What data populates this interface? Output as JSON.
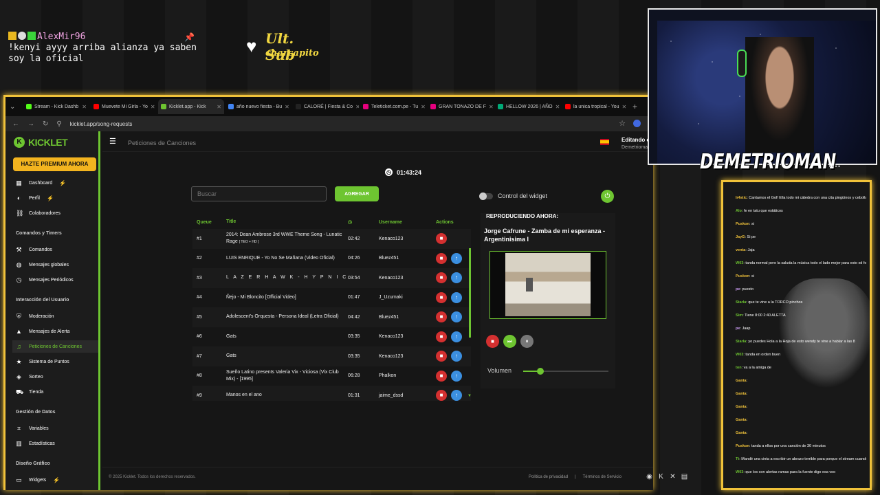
{
  "stream_chat": {
    "user": "AlexMir96",
    "message_line1": "!kenyi ayyy arriba alianza ya saben",
    "message_line2": "soy la oficial"
  },
  "sub_alert": {
    "title": "Ult. Sub",
    "name": "charcapito"
  },
  "browser": {
    "tabs": [
      {
        "label": "Stream - Kick Dashb",
        "color": "#53fc18"
      },
      {
        "label": "Muevete Mi Girla - Yo",
        "color": "#ff0000"
      },
      {
        "label": "Kicklet.app - Kick",
        "color": "#6ec531",
        "active": true
      },
      {
        "label": "año nuevo fiesta - Bu",
        "color": "#4285f4"
      },
      {
        "label": "CALORÉ | Fiesta & Co",
        "color": "#222222"
      },
      {
        "label": "Teleticket.com.pe - Tu",
        "color": "#e6007e"
      },
      {
        "label": "GRAN TONAZO DE F",
        "color": "#e6007e"
      },
      {
        "label": "HELLOW 2026 | AÑO",
        "color": "#00aa77"
      },
      {
        "label": "la unica tropical - You",
        "color": "#ff0000"
      }
    ],
    "url": "kicklet.app/song-requests"
  },
  "kicklet": {
    "logo": "KICKLET",
    "premium_button": "HAZTE PREMIUM AHORA",
    "sidebar": {
      "main": [
        {
          "label": "Dashboard",
          "icon": "grid-icon"
        },
        {
          "label": "Perfil",
          "icon": "user-icon"
        },
        {
          "label": "Colaboradores",
          "icon": "link-icon"
        }
      ],
      "section_commands": "Comandos y Timers",
      "commands": [
        {
          "label": "Comandos",
          "icon": "hammer-icon"
        },
        {
          "label": "Mensajes globales",
          "icon": "globe-icon"
        },
        {
          "label": "Mensajes Periódicos",
          "icon": "clock-icon"
        }
      ],
      "section_interaction": "Interacción del Usuario",
      "interaction": [
        {
          "label": "Moderación",
          "icon": "shield-icon"
        },
        {
          "label": "Mensajes de Alerta",
          "icon": "alert-icon"
        },
        {
          "label": "Peticiones de Canciones",
          "icon": "music-icon"
        },
        {
          "label": "Sistema de Puntos",
          "icon": "star-icon"
        },
        {
          "label": "Sorteo",
          "icon": "gift-icon"
        },
        {
          "label": "Tienda",
          "icon": "cart-icon"
        }
      ],
      "section_data": "Gestión de Datos",
      "data": [
        {
          "label": "Variables",
          "icon": "code-icon"
        },
        {
          "label": "Estadísticas",
          "icon": "chart-icon"
        }
      ],
      "section_design": "Diseño Gráfico",
      "design": [
        {
          "label": "Widgets",
          "icon": "widget-icon"
        }
      ]
    },
    "header_title": "Peticiones de Canciones",
    "editing_label": "Editando co",
    "editing_user": "Demetrioman",
    "timer": "01:43:24",
    "search_placeholder": "Buscar",
    "add_button": "AGREGAR",
    "widget_control_label": "Control del widget",
    "table": {
      "headers": {
        "queue": "Queue",
        "title": "Title",
        "username": "Username",
        "actions": "Actions"
      },
      "rows": [
        {
          "queue": "#1",
          "title": "2014: Dean Ambrose 3rd WWE Theme Song - Lunatic Rage",
          "badge": "[ TEO + HD ]",
          "duration": "02:42",
          "username": "Kenaco123"
        },
        {
          "queue": "#2",
          "title": "LUIS ENRIQUE - Yo No Se Mañana (Video Oficial)",
          "duration": "04:26",
          "username": "Bluez451"
        },
        {
          "queue": "#3",
          "title": "L A Z E R H A W K - H Y P N I C",
          "duration": "03:54",
          "username": "Kenaco123"
        },
        {
          "queue": "#4",
          "title": "Ñejo - Mi Bloncito [Official Video]",
          "duration": "01:47",
          "username": "J_Uzumaki"
        },
        {
          "queue": "#5",
          "title": "Adolescent's Orquesta - Persona Ideal (Letra Oficial)",
          "duration": "04:42",
          "username": "Bluez451"
        },
        {
          "queue": "#6",
          "title": "Gats",
          "duration": "03:35",
          "username": "Kenaco123"
        },
        {
          "queue": "#7",
          "title": "Gats",
          "duration": "03:35",
          "username": "Kenaco123"
        },
        {
          "queue": "#8",
          "title": "Sueño Latino presents Valeria Vix - Viciosa (Vix Club Mix) - [1995]",
          "duration": "06:28",
          "username": "Phalkon"
        },
        {
          "queue": "#9",
          "title": "Manos en el ano",
          "duration": "01:31",
          "username": "jaime_dssd"
        }
      ]
    },
    "now_playing": {
      "heading": "REPRODUCIENDO AHORA:",
      "song": "Jorge Cafrune - Zamba de mi esperanza - Argentinisima I",
      "volume_label": "Volumen",
      "volume": 0.2
    },
    "footer": {
      "copyright": "© 2025 Kicklet. Todos los derechos reservados.",
      "privacy": "Política de privacidad",
      "separator": "|",
      "terms": "Términos de Servicio"
    }
  },
  "webcam": {
    "streamer_name": "DEMETRIOMAN"
  },
  "kick_chat": [
    {
      "user": "Ir4stic",
      "msg": "Cantamos el Gol! Ella todo mi cátedra con una cita pingüinos y cebollas tus",
      "color": "y"
    },
    {
      "user": "Alo",
      "msg": "fe en tatu que estáticos",
      "color": "g"
    },
    {
      "user": "Puskon",
      "msg": "si",
      "color": "y"
    },
    {
      "user": "JayG",
      "msg": "Si pe",
      "color": "y"
    },
    {
      "user": "venta",
      "msg": "Jaja",
      "color": "y"
    },
    {
      "user": "W03",
      "msg": "tanda normal pero la saluda la música todo el lado mejor para esto xd forma",
      "color": "g"
    },
    {
      "user": "Puskon",
      "msg": "si",
      "color": "y"
    },
    {
      "user": "pe",
      "msg": "puesto",
      "color": "p"
    },
    {
      "user": "Starla",
      "msg": "que te vine a la TORCO pinchos",
      "color": "g"
    },
    {
      "user": "Sim",
      "msg": "Tiene 8:00 2:40 ALETTA",
      "color": "g"
    },
    {
      "user": "pe",
      "msg": "Jaap",
      "color": "p"
    },
    {
      "user": "Starla",
      "msg": "yo puedes Hola a la Hoja de esto wendy te vine a hablar a las 8",
      "color": "g"
    },
    {
      "user": "W03",
      "msg": "tanda en orden buen",
      "color": "g"
    },
    {
      "user": "ton",
      "msg": "va a la amiga de",
      "color": "g"
    },
    {
      "user": "Ganta",
      "msg": "",
      "color": "y"
    },
    {
      "user": "Ganta",
      "msg": "",
      "color": "y"
    },
    {
      "user": "Ganta",
      "msg": "",
      "color": "y"
    },
    {
      "user": "Ganta",
      "msg": "",
      "color": "y"
    },
    {
      "user": "Ganta",
      "msg": "",
      "color": "y"
    },
    {
      "user": "Puskon",
      "msg": "tanda a ellos por una canción de 30 minutos",
      "color": "y"
    },
    {
      "user": "Tt",
      "msg": "Mandé una cinta a escribir un abrazo terrible para porque el stream cuando esa mensaje",
      "color": "g"
    },
    {
      "user": "W03",
      "msg": "que los con alertas ramas para la fuente digo esa voo",
      "color": "g"
    }
  ]
}
